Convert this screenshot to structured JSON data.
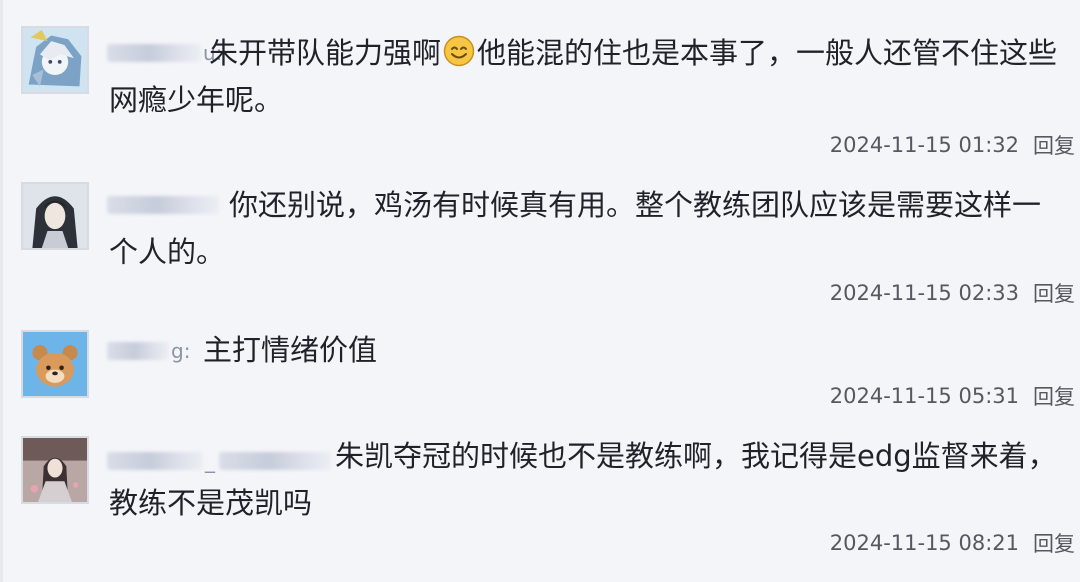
{
  "comments": [
    {
      "user_tail": "u:",
      "text_before_emoji": "朱开带队能力强啊",
      "emoji": "smile-emoji-icon",
      "text_after_emoji": "他能混的住也是本事了，一般人还管不住这些网瘾少年呢。",
      "time": "2024-11-15 01:32",
      "reply": "回复"
    },
    {
      "user_tail": "",
      "text": "你还别说，鸡汤有时候真有用。整个教练团队应该是需要这样一个人的。",
      "time": "2024-11-15 02:33",
      "reply": "回复"
    },
    {
      "user_tail": "g:",
      "text": "主打情绪价值",
      "time": "2024-11-15 05:31",
      "reply": "回复"
    },
    {
      "user_tail": "_",
      "text": "朱凯夺冠的时候也不是教练啊，我记得是edg监督来着，教练不是茂凯吗",
      "time": "2024-11-15 08:21",
      "reply": "回复"
    }
  ],
  "colors": {
    "panel_bg": "#f4f5f9",
    "text": "#1f2329",
    "meta": "#55595f"
  }
}
